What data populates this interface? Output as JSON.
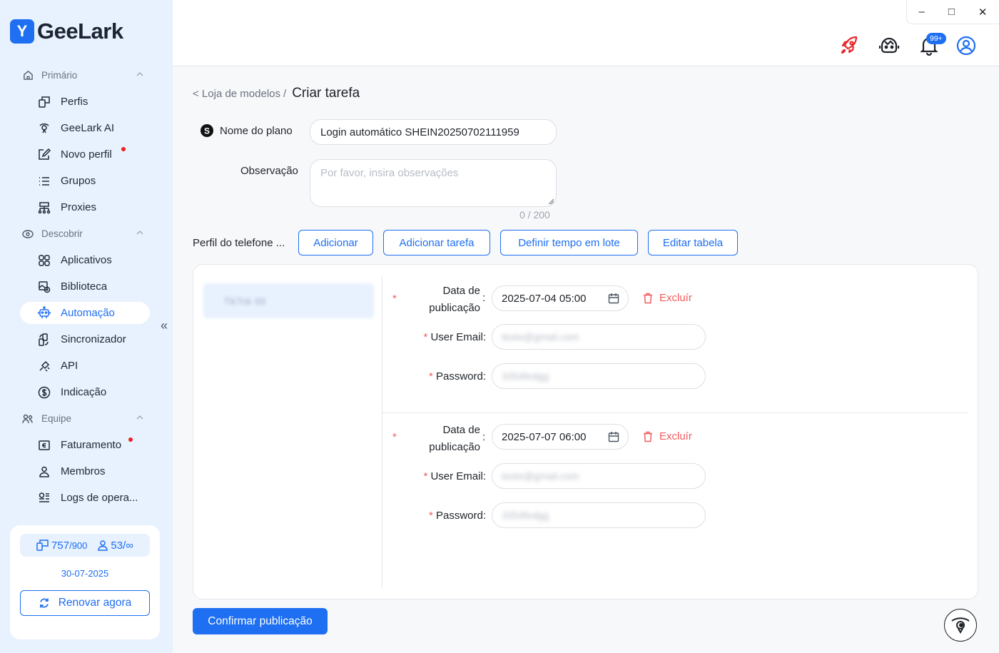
{
  "app": {
    "name": "GeeLark",
    "logo_mark": "Y"
  },
  "colors": {
    "accent": "#1e6ff1",
    "sidebar_bg": "#e8f1fe",
    "danger": "#f25c5c",
    "dot": "#f21f1f"
  },
  "window_controls": {
    "minimize": "–",
    "maximize": "□",
    "close": "✕"
  },
  "header": {
    "notification_badge": "99+",
    "icons": [
      "rocket-icon",
      "support-bot-icon",
      "bell-icon",
      "account-icon"
    ]
  },
  "sidebar": {
    "sections": [
      {
        "label": "Primário",
        "icon": "home-icon"
      },
      {
        "label": "Descobrir",
        "icon": "discover-icon"
      },
      {
        "label": "Equipe",
        "icon": "team-icon"
      }
    ],
    "items": [
      {
        "label": "Perfis",
        "icon": "profiles-icon"
      },
      {
        "label": "GeeLark AI",
        "icon": "ai-icon"
      },
      {
        "label": "Novo perfil",
        "icon": "edit-icon",
        "dot": true
      },
      {
        "label": "Grupos",
        "icon": "list-icon"
      },
      {
        "label": "Proxies",
        "icon": "proxy-icon"
      },
      {
        "label": "Aplicativos",
        "icon": "apps-icon"
      },
      {
        "label": "Biblioteca",
        "icon": "library-icon"
      },
      {
        "label": "Automação",
        "icon": "robot-icon",
        "active": true
      },
      {
        "label": "Sincronizador",
        "icon": "sync-icon"
      },
      {
        "label": "API",
        "icon": "api-icon"
      },
      {
        "label": "Indicação",
        "icon": "dollar-icon"
      },
      {
        "label": "Faturamento",
        "icon": "billing-icon",
        "dot": true
      },
      {
        "label": "Membros",
        "icon": "member-icon"
      },
      {
        "label": "Logs de opera...",
        "icon": "logs-icon"
      }
    ],
    "collapse": "«",
    "plan": {
      "profiles_used": "757",
      "profiles_total": "/900",
      "members_used": "53",
      "members_total": "/∞",
      "expiry": "30-07-2025",
      "renew_label": "Renovar agora"
    }
  },
  "breadcrumb": {
    "parent": "< Loja de modelos",
    "separator": "/",
    "current": "Criar tarefa"
  },
  "form": {
    "plan_name_label": "Nome do plano",
    "plan_name_value": "Login automático SHEIN20250702111959",
    "note_label": "Observação",
    "note_placeholder": "Por favor, insira observações",
    "note_counter": "0 / 200",
    "phone_profile_label": "Perfil do telefone ...",
    "buttons": {
      "add": "Adicionar",
      "add_task": "Adicionar tarefa",
      "batch_time": "Definir tempo em lote",
      "edit_table": "Editar tabela"
    }
  },
  "profiles": [
    {
      "name": "TikTok 88"
    }
  ],
  "tasks": [
    {
      "date_label_1": "Data de",
      "date_label_2": "publicação",
      "date_value": "2025-07-04 05:00",
      "delete_label": "Excluír",
      "email_label": "User Email",
      "email_value": "teste@gmail.com",
      "password_label": "Password",
      "password_value": "3354fedgg"
    },
    {
      "date_label_1": "Data de",
      "date_label_2": "publicação",
      "date_value": "2025-07-07 06:00",
      "delete_label": "Excluír",
      "email_label": "User Email",
      "email_value": "teste@gmail.com",
      "password_label": "Password",
      "password_value": "3354fedgg"
    }
  ],
  "required_mark": "*",
  "colon": ":",
  "confirm_label": "Confirmar publicação"
}
